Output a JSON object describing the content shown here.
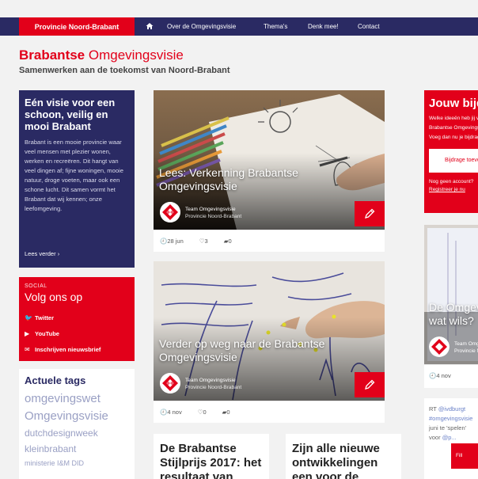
{
  "nav": {
    "brand": "Provincie Noord-Brabant",
    "items": [
      "Over de Omgevingsvisie",
      "Thema's",
      "Denk mee!",
      "Contact"
    ]
  },
  "header": {
    "title_bold": "Brabantse",
    "title_rest": " Omgevingsvisie",
    "subtitle": "Samenwerken aan de toekomst van Noord-Brabant"
  },
  "visie": {
    "title": "Eén visie voor een schoon, veilig en mooi Brabant",
    "body": "Brabant is een mooie provincie waar veel mensen met plezier wonen, werken en recreëren. Dit hangt van veel dingen af; fijne woningen, mooie natuur, droge voeten, maar ook een schone lucht. Dit samen vormt het Brabant dat wij kennen; onze leefomgeving.",
    "more": "Lees verder ›"
  },
  "social": {
    "label": "SOCIAL",
    "heading": "Volg ons op",
    "links": [
      "Twitter",
      "YouTube",
      "Inschrijven nieuwsbrief"
    ]
  },
  "tags": {
    "heading": "Actuele tags",
    "items": [
      "omgevingswet",
      "Omgevingsvisie",
      "dutchdesignweek",
      "kleinbrabant",
      "ministerie I&M DID"
    ]
  },
  "cards": [
    {
      "title": "Lees: Verkenning Brabantse Omgevingsvisie",
      "author": "Team Omgevingsvisie",
      "org": "Provincie Noord-Brabant",
      "date": "28 jun",
      "likes": "3",
      "comments": "0"
    },
    {
      "title": "Verder op weg naar de Brabantse Omgevingsvisie",
      "author": "Team Omgevingsvisie",
      "org": "Provincie Noord-Brabant",
      "date": "4 nov",
      "likes": "0",
      "comments": "0"
    }
  ],
  "text_cards": [
    {
      "title": "De Brabantse Stijlprijs 2017: het resultaat van"
    },
    {
      "title": "Zijn alle nieuwe ontwikkelingen een voor de"
    }
  ],
  "jouw": {
    "title": "Jouw bijdrage",
    "lines": [
      "Welke ideeën heb jij voor de",
      "Brabantse Omgevingsvisie?",
      "Voeg dan nu je bijdrage toe"
    ],
    "button": "Bijdrage toevoegen",
    "no_account": "Nog geen account?",
    "register": "Registreer je nu"
  },
  "rcard": {
    "title": "De Omgevingswet, wat wils?",
    "author": "Team Omgevingsvisie",
    "org": "Provincie Noord-Brabant",
    "date": "4 nov"
  },
  "tweet": {
    "rt": "RT ",
    "handle": "@ivdburgt",
    "tag": "#omgevingsvisie",
    "text1": "juni te 'spelen'",
    "text2": "voor ",
    "link": "@p...",
    "button": "Fill"
  },
  "colors": {
    "navy": "#2a2a63",
    "red": "#e2001a"
  }
}
